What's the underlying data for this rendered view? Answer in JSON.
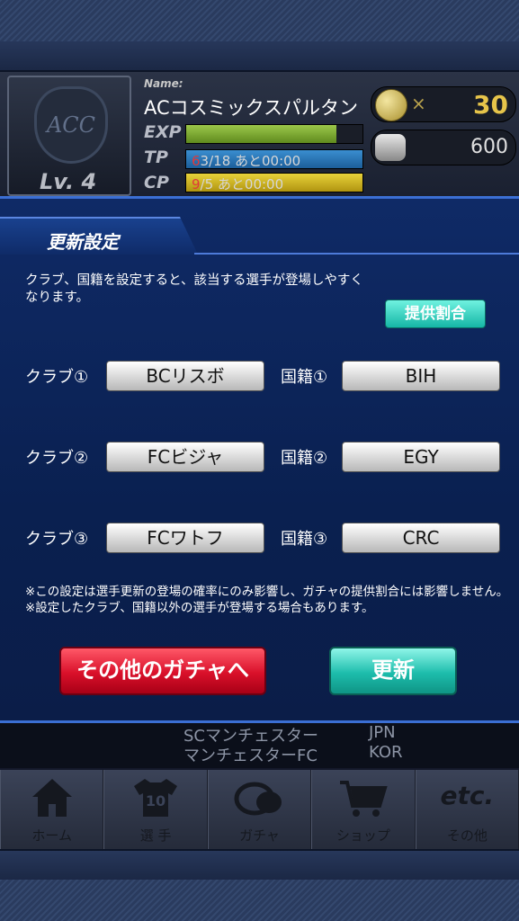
{
  "header": {
    "name_label": "Name:",
    "player_name": "ACコスミックスパルタン",
    "level": "Lv. 4",
    "exp_label": "EXP",
    "exp_progress": 0.85,
    "tp_label": "TP",
    "tp_current": "6",
    "tp_text": "3/18 あと00:00",
    "cp_label": "CP",
    "cp_current": "9",
    "cp_text": "/5 あと00:00",
    "coin_x": "×",
    "coins": "30",
    "silver": "600"
  },
  "modal": {
    "title": "更新設定",
    "description": "クラブ、国籍を設定すると、該当する選手が登場しやすくなります。",
    "rate_button": "提供割合",
    "filters": [
      {
        "club_label": "クラブ①",
        "club_value": "BCリスボ",
        "nation_label": "国籍①",
        "nation_value": "BIH"
      },
      {
        "club_label": "クラブ②",
        "club_value": "FCビジャ",
        "nation_label": "国籍②",
        "nation_value": "EGY"
      },
      {
        "club_label": "クラブ③",
        "club_value": "FCワトフ",
        "nation_label": "国籍③",
        "nation_value": "CRC"
      }
    ],
    "note1": "※この設定は選手更新の登場の確率にのみ影響し、ガチャの提供割合には影響しません。",
    "note2": "※設定したクラブ、国籍以外の選手が登場する場合もあります。",
    "other_button": "その他のガチャへ",
    "update_button": "更新"
  },
  "background_list": {
    "rows": [
      {
        "club": "SCマンチェスター",
        "nation": "JPN"
      },
      {
        "club": "マンチェスターFC",
        "nation": "KOR"
      }
    ]
  },
  "nav": {
    "items": [
      {
        "label": "ホーム",
        "icon": "home-icon"
      },
      {
        "label": "選 手",
        "icon": "jersey-icon",
        "glyph": "10"
      },
      {
        "label": "ガチャ",
        "icon": "capsule-icon"
      },
      {
        "label": "ショップ",
        "icon": "cart-icon"
      },
      {
        "label": "その他",
        "icon": "etc-icon",
        "glyph": "etc."
      }
    ]
  }
}
